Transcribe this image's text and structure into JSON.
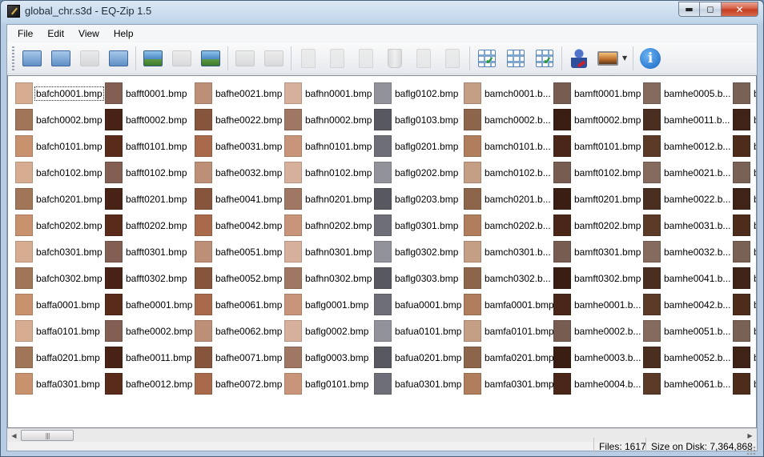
{
  "window": {
    "title": "global_chr.s3d - EQ-Zip 1.5"
  },
  "menu": [
    "File",
    "Edit",
    "View",
    "Help"
  ],
  "toolbar": [
    {
      "icon": "new-archive-icon",
      "enabled": true,
      "kind": "folder"
    },
    {
      "icon": "open-archive-icon",
      "enabled": true,
      "kind": "folder"
    },
    {
      "icon": "extract-icon",
      "enabled": false,
      "kind": "folder"
    },
    {
      "icon": "save-archive-icon",
      "enabled": true,
      "kind": "folder"
    },
    {
      "sep": true
    },
    {
      "icon": "import-image-icon",
      "enabled": true,
      "kind": "img"
    },
    {
      "icon": "export-image-icon",
      "enabled": false,
      "kind": "img"
    },
    {
      "icon": "convert-image-icon",
      "enabled": true,
      "kind": "img"
    },
    {
      "sep": true
    },
    {
      "icon": "replace-image-icon",
      "enabled": false,
      "kind": "img"
    },
    {
      "icon": "insert-image-icon",
      "enabled": false,
      "kind": "img"
    },
    {
      "sep": true
    },
    {
      "icon": "cut-icon",
      "enabled": false,
      "kind": "doc"
    },
    {
      "icon": "copy-icon",
      "enabled": false,
      "kind": "doc"
    },
    {
      "icon": "paste-icon",
      "enabled": false,
      "kind": "doc"
    },
    {
      "icon": "trash-icon",
      "enabled": false,
      "kind": "trash"
    },
    {
      "icon": "rename-icon",
      "enabled": false,
      "kind": "doc"
    },
    {
      "icon": "properties-icon",
      "enabled": false,
      "kind": "doc"
    },
    {
      "sep": true
    },
    {
      "icon": "select-all-icon",
      "enabled": true,
      "kind": "grid",
      "check": true
    },
    {
      "icon": "select-none-icon",
      "enabled": true,
      "kind": "grid",
      "check": false
    },
    {
      "icon": "invert-selection-icon",
      "enabled": true,
      "kind": "grid",
      "check": true
    },
    {
      "sep": true
    },
    {
      "icon": "user-icon",
      "enabled": true,
      "kind": "person"
    },
    {
      "icon": "view-mode-icon",
      "enabled": true,
      "kind": "picture",
      "dropdown": true
    },
    {
      "sep": true
    },
    {
      "icon": "info-icon",
      "enabled": true,
      "kind": "info"
    }
  ],
  "columns": [
    {
      "color": "#c9926e",
      "items": [
        "bafch0001.bmp",
        "bafch0002.bmp",
        "bafch0101.bmp",
        "bafch0102.bmp",
        "bafch0201.bmp",
        "bafch0202.bmp",
        "bafch0301.bmp",
        "bafch0302.bmp",
        "baffa0001.bmp",
        "baffa0101.bmp",
        "baffa0201.bmp",
        "baffa0301.bmp"
      ]
    },
    {
      "color": "#5a2a1a",
      "items": [
        "bafft0001.bmp",
        "bafft0002.bmp",
        "bafft0101.bmp",
        "bafft0102.bmp",
        "bafft0201.bmp",
        "bafft0202.bmp",
        "bafft0301.bmp",
        "bafft0302.bmp",
        "bafhe0001.bmp",
        "bafhe0002.bmp",
        "bafhe0011.bmp",
        "bafhe0012.bmp"
      ]
    },
    {
      "color": "#a86a4a",
      "items": [
        "bafhe0021.bmp",
        "bafhe0022.bmp",
        "bafhe0031.bmp",
        "bafhe0032.bmp",
        "bafhe0041.bmp",
        "bafhe0042.bmp",
        "bafhe0051.bmp",
        "bafhe0052.bmp",
        "bafhe0061.bmp",
        "bafhe0062.bmp",
        "bafhe0071.bmp",
        "bafhe0072.bmp"
      ]
    },
    {
      "color": "#c8957a",
      "items": [
        "bafhn0001.bmp",
        "bafhn0002.bmp",
        "bafhn0101.bmp",
        "bafhn0102.bmp",
        "bafhn0201.bmp",
        "bafhn0202.bmp",
        "bafhn0301.bmp",
        "bafhn0302.bmp",
        "baflg0001.bmp",
        "baflg0002.bmp",
        "baflg0003.bmp",
        "baflg0101.bmp"
      ]
    },
    {
      "color": "#6e6e78",
      "items": [
        "baflg0102.bmp",
        "baflg0103.bmp",
        "baflg0201.bmp",
        "baflg0202.bmp",
        "baflg0203.bmp",
        "baflg0301.bmp",
        "baflg0302.bmp",
        "baflg0303.bmp",
        "bafua0001.bmp",
        "bafua0101.bmp",
        "bafua0201.bmp",
        "bafua0301.bmp"
      ]
    },
    {
      "color": "#b07e5c",
      "items": [
        "bamch0001.b...",
        "bamch0002.b...",
        "bamch0101.b...",
        "bamch0102.b...",
        "bamch0201.b...",
        "bamch0202.b...",
        "bamch0301.b...",
        "bamch0302.b...",
        "bamfa0001.bmp",
        "bamfa0101.bmp",
        "bamfa0201.bmp",
        "bamfa0301.bmp"
      ]
    },
    {
      "color": "#4a2618",
      "items": [
        "bamft0001.bmp",
        "bamft0002.bmp",
        "bamft0101.bmp",
        "bamft0102.bmp",
        "bamft0201.bmp",
        "bamft0202.bmp",
        "bamft0301.bmp",
        "bamft0302.bmp",
        "bamhe0001.b...",
        "bamhe0002.b...",
        "bamhe0003.b...",
        "bamhe0004.b..."
      ]
    },
    {
      "color": "#5c3a28",
      "items": [
        "bamhe0005.b...",
        "bamhe0011.b...",
        "bamhe0012.b...",
        "bamhe0021.b...",
        "bamhe0022.b...",
        "bamhe0031.b...",
        "bamhe0032.b...",
        "bamhe0041.b...",
        "bamhe0042.b...",
        "bamhe0051.b...",
        "bamhe0052.b...",
        "bamhe0061.b..."
      ]
    },
    {
      "color": "#4e2c1c",
      "items": [
        "b",
        "b",
        "b",
        "b",
        "b",
        "b",
        "b",
        "b",
        "b",
        "b",
        "b",
        "b"
      ]
    }
  ],
  "status": {
    "files": "Files: 1617",
    "size": "Size on Disk: 7,364,868"
  }
}
